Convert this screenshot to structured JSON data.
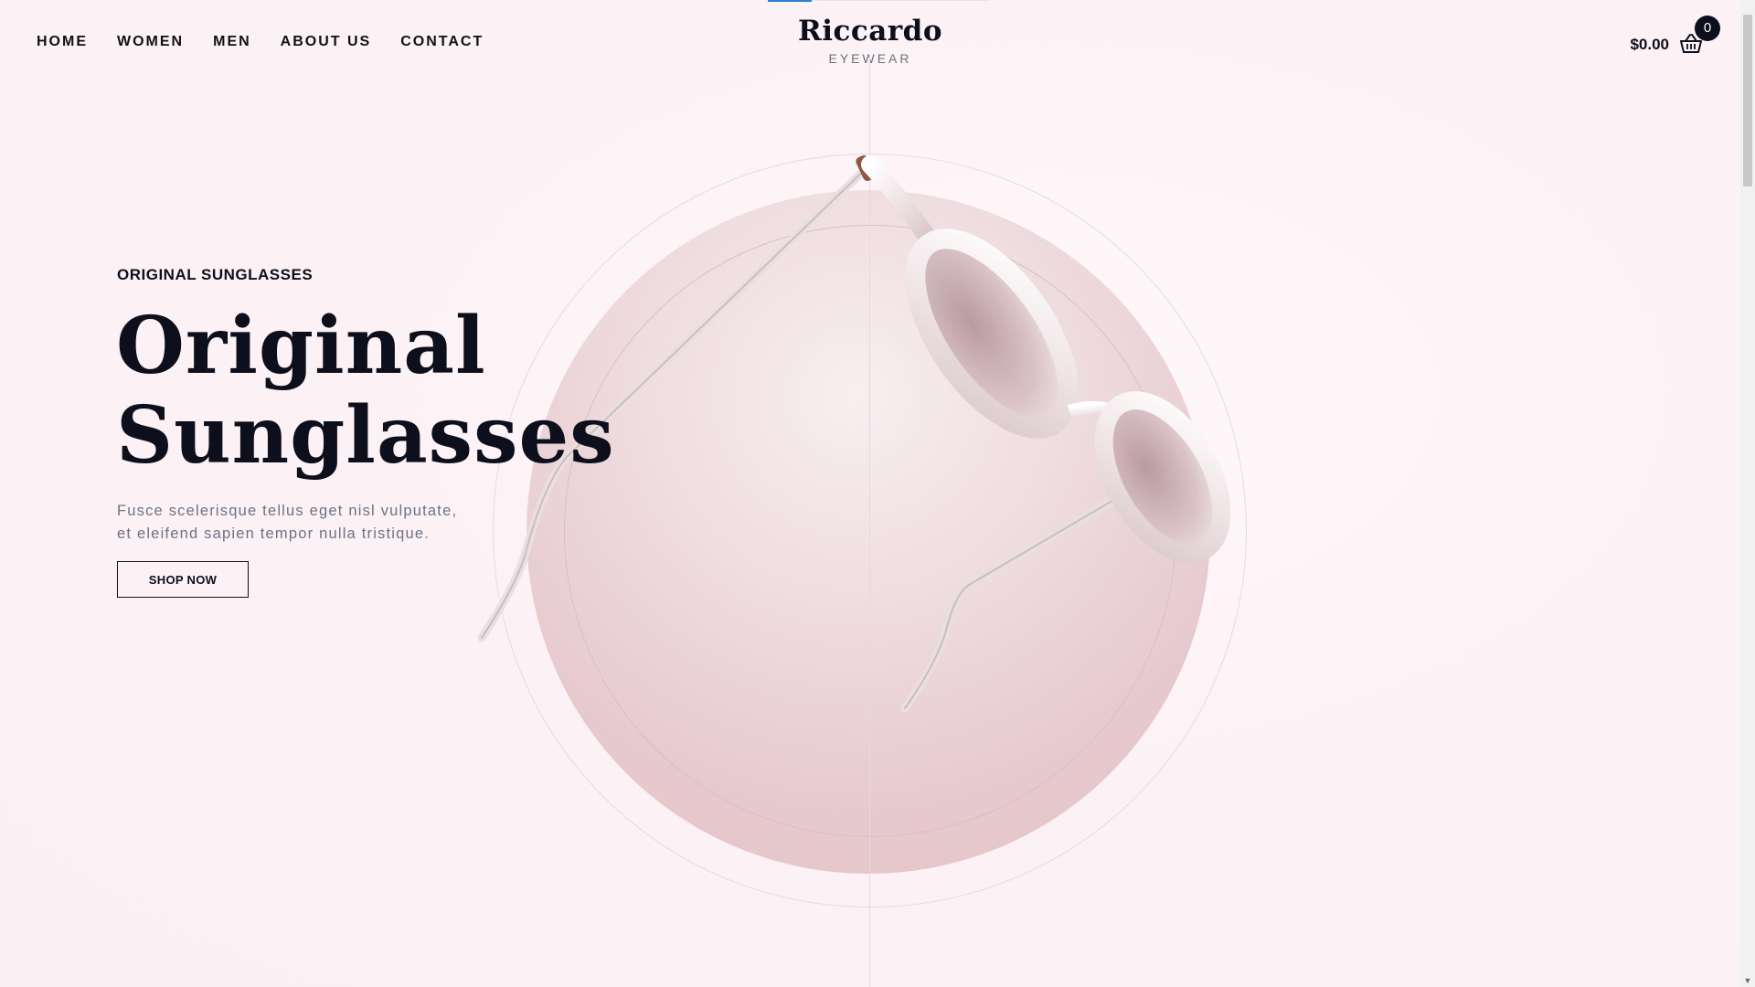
{
  "nav": {
    "items": [
      {
        "label": "HOME"
      },
      {
        "label": "WOMEN"
      },
      {
        "label": "MEN"
      },
      {
        "label": "ABOUT US"
      },
      {
        "label": "CONTACT"
      }
    ]
  },
  "brand": {
    "name": "Riccardo",
    "subtitle": "EYEWEAR"
  },
  "cart": {
    "total": "$0.00",
    "count": "0",
    "icon": "basket-icon"
  },
  "hero": {
    "eyebrow": "ORIGINAL SUNGLASSES",
    "title_line1": "Original",
    "title_line2": "Sunglasses",
    "description_line1": "Fusce scelerisque tellus eget nisl vulputate,",
    "description_line2": "et eleifend sapien tempor nulla tristique.",
    "cta_label": "SHOP NOW"
  },
  "colors": {
    "background": "#fcf3f6",
    "text_dark": "#0d0f1c",
    "text_muted": "#6d7283",
    "blob_pink": "#e6c9ce",
    "accent_blue": "#2b7fd1"
  }
}
